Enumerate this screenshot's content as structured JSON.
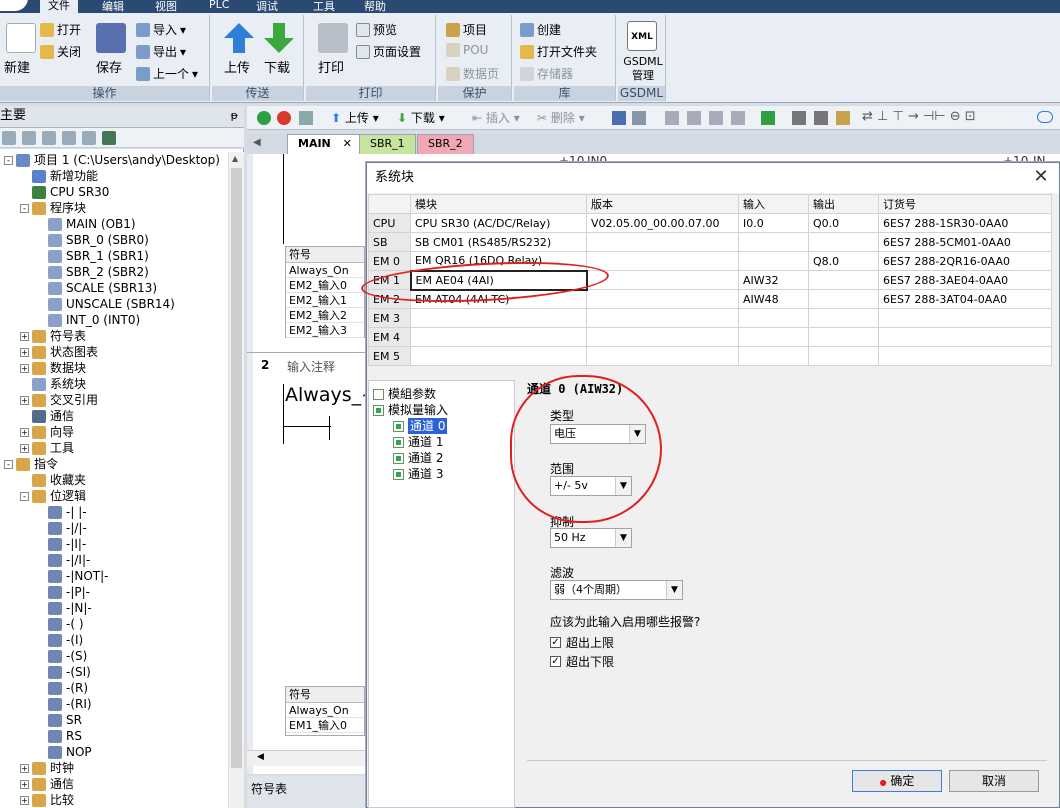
{
  "menu": {
    "items": [
      "文件",
      "编辑",
      "视图",
      "PLC",
      "调试",
      "工具",
      "帮助"
    ]
  },
  "ribbon": {
    "groups": {
      "ops": {
        "label": "操作",
        "new": "新建",
        "open": "打开",
        "close": "关闭",
        "save": "保存",
        "import": "导入",
        "export": "导出",
        "prev": "上一个"
      },
      "transfer": {
        "label": "传送",
        "upload": "上传",
        "download": "下载"
      },
      "print": {
        "label": "打印",
        "print": "打印",
        "preview": "预览",
        "pagesetup": "页面设置"
      },
      "protect": {
        "label": "保护",
        "project": "项目",
        "pou": "POU",
        "datapage": "数据页"
      },
      "lib": {
        "label": "库",
        "create": "创建",
        "openfolder": "打开文件夹",
        "memory": "存储器"
      },
      "gsdml": {
        "label": "GSDML",
        "text": "GSDML 管理",
        "icon_text": "XML"
      }
    }
  },
  "tree": {
    "header": "主要",
    "items": [
      {
        "label": "项目 1 (C:\\Users\\andy\\Desktop)",
        "icon": "project-icon",
        "color": "#6b89c4"
      },
      {
        "label": "新增功能",
        "icon": "help-icon",
        "color": "#5a7fcf"
      },
      {
        "label": "CPU SR30",
        "icon": "cpu-icon",
        "color": "#3f7f3f"
      },
      {
        "label": "程序块",
        "icon": "folder-icon",
        "color": "#d7a64a"
      },
      {
        "label": "MAIN (OB1)",
        "icon": "block-icon",
        "color": "#8aa0c6"
      },
      {
        "label": "SBR_0 (SBR0)",
        "icon": "block-icon",
        "color": "#8aa0c6"
      },
      {
        "label": "SBR_1 (SBR1)",
        "icon": "block-icon",
        "color": "#8aa0c6"
      },
      {
        "label": "SBR_2 (SBR2)",
        "icon": "block-icon",
        "color": "#8aa0c6"
      },
      {
        "label": "SCALE (SBR13)",
        "icon": "block-icon",
        "color": "#8aa0c6"
      },
      {
        "label": "UNSCALE (SBR14)",
        "icon": "block-icon",
        "color": "#8aa0c6"
      },
      {
        "label": "INT_0 (INT0)",
        "icon": "block-icon",
        "color": "#8aa0c6"
      },
      {
        "label": "符号表",
        "icon": "folder-icon",
        "color": "#d7a64a"
      },
      {
        "label": "状态图表",
        "icon": "folder-icon",
        "color": "#d7a64a"
      },
      {
        "label": "数据块",
        "icon": "folder-icon",
        "color": "#d7a64a"
      },
      {
        "label": "系统块",
        "icon": "system-block-icon",
        "color": "#8aa0c6"
      },
      {
        "label": "交叉引用",
        "icon": "folder-icon",
        "color": "#d7a64a"
      },
      {
        "label": "通信",
        "icon": "comm-icon",
        "color": "#556b8a"
      },
      {
        "label": "向导",
        "icon": "wizard-icon",
        "color": "#d7a64a"
      },
      {
        "label": "工具",
        "icon": "folder-icon",
        "color": "#d7a64a"
      },
      {
        "label": "指令",
        "icon": "folder-icon",
        "color": "#d7a64a"
      },
      {
        "label": "收藏夹",
        "icon": "favorites-icon",
        "color": "#d7a64a"
      },
      {
        "label": "位逻辑",
        "icon": "folder-icon",
        "color": "#d7a64a"
      },
      {
        "label": "-| |-",
        "icon": "contact-icon",
        "color": "#6f88b3"
      },
      {
        "label": "-|/|-",
        "icon": "contact-icon",
        "color": "#6f88b3"
      },
      {
        "label": "-|I|-",
        "icon": "contact-icon",
        "color": "#6f88b3"
      },
      {
        "label": "-|/I|-",
        "icon": "contact-icon",
        "color": "#6f88b3"
      },
      {
        "label": "-|NOT|-",
        "icon": "contact-icon",
        "color": "#6f88b3"
      },
      {
        "label": "-|P|-",
        "icon": "contact-icon",
        "color": "#6f88b3"
      },
      {
        "label": "-|N|-",
        "icon": "contact-icon",
        "color": "#6f88b3"
      },
      {
        "label": "-( )",
        "icon": "coil-icon",
        "color": "#6f88b3"
      },
      {
        "label": "-(I)",
        "icon": "coil-icon",
        "color": "#6f88b3"
      },
      {
        "label": "-(S)",
        "icon": "coil-icon",
        "color": "#6f88b3"
      },
      {
        "label": "-(SI)",
        "icon": "coil-icon",
        "color": "#6f88b3"
      },
      {
        "label": "-(R)",
        "icon": "coil-icon",
        "color": "#6f88b3"
      },
      {
        "label": "-(RI)",
        "icon": "coil-icon",
        "color": "#6f88b3"
      },
      {
        "label": "SR",
        "icon": "box-icon",
        "color": "#6f88b3"
      },
      {
        "label": "RS",
        "icon": "box-icon",
        "color": "#6f88b3"
      },
      {
        "label": "NOP",
        "icon": "box-icon",
        "color": "#6f88b3"
      },
      {
        "label": "时钟",
        "icon": "folder-icon",
        "color": "#d7a64a"
      },
      {
        "label": "通信",
        "icon": "folder-icon",
        "color": "#d7a64a"
      },
      {
        "label": "比较",
        "icon": "folder-icon",
        "color": "#d7a64a"
      }
    ]
  },
  "editor": {
    "toolbar": {
      "upload": "上传",
      "download": "下载",
      "insert": "插入",
      "delete": "删除"
    },
    "tabs": [
      "MAIN",
      "SBR_1",
      "SBR_2"
    ],
    "symbol_header": "符号",
    "symbols_top": [
      "Always_On",
      "EM2_输入0",
      "EM2_输入1",
      "EM2_输入2",
      "EM2_输入3"
    ],
    "network2_num": "2",
    "network2_comment": "输入注释",
    "always_label": "Always_~",
    "symbol_header2": "符号",
    "symbols_bottom": [
      "Always_On",
      "EM1_输入0"
    ],
    "bottom_tab": "符号表",
    "rung_top_a": "+10",
    "rung_top_b": "IN0",
    "rung_top_c": "+10",
    "rung_top_d": "IN"
  },
  "dialog": {
    "title": "系统块",
    "columns": [
      "",
      "模块",
      "版本",
      "输入",
      "输出",
      "订货号"
    ],
    "rows": [
      {
        "slot": "CPU",
        "module": "CPU SR30 (AC/DC/Relay)",
        "version": "V02.05.00_00.00.07.00",
        "input": "I0.0",
        "output": "Q0.0",
        "order": "6ES7 288-1SR30-0AA0"
      },
      {
        "slot": "SB",
        "module": "SB CM01 (RS485/RS232)",
        "version": "",
        "input": "",
        "output": "",
        "order": "6ES7 288-5CM01-0AA0"
      },
      {
        "slot": "EM 0",
        "module": "EM QR16 (16DQ Relay)",
        "version": "",
        "input": "",
        "output": "Q8.0",
        "order": "6ES7 288-2QR16-0AA0"
      },
      {
        "slot": "EM 1",
        "module": "EM AE04 (4AI)",
        "version": "",
        "input": "AIW32",
        "output": "",
        "order": "6ES7 288-3AE04-0AA0"
      },
      {
        "slot": "EM 2",
        "module": "EM AT04 (4AI TC)",
        "version": "",
        "input": "AIW48",
        "output": "",
        "order": "6ES7 288-3AT04-0AA0"
      },
      {
        "slot": "EM 3",
        "module": "",
        "version": "",
        "input": "",
        "output": "",
        "order": ""
      },
      {
        "slot": "EM 4",
        "module": "",
        "version": "",
        "input": "",
        "output": "",
        "order": ""
      },
      {
        "slot": "EM 5",
        "module": "",
        "version": "",
        "input": "",
        "output": "",
        "order": ""
      }
    ],
    "nav": {
      "module_params": "模組参数",
      "analog_input": "模拟量输入",
      "channels": [
        "通道 0",
        "通道 1",
        "通道 2",
        "通道 3"
      ]
    },
    "props": {
      "channel_title": "通道 0 (AIW32)",
      "type_label": "类型",
      "type_value": "电压",
      "range_label": "范围",
      "range_value": "+/- 5v",
      "rejection_label": "抑制",
      "rejection_value": "50 Hz",
      "filter_label": "滤波",
      "filter_value": "弱（4个周期）",
      "alarm_question": "应该为此输入启用哪些报警?",
      "alarm_upper": "超出上限",
      "alarm_lower": "超出下限",
      "alarm_upper_checked": true,
      "alarm_lower_checked": true
    },
    "ok": "确定",
    "cancel": "取消"
  },
  "colors": {
    "accent": "#2b62d6",
    "annotation": "#e02020",
    "menubar": "#2b4a73"
  }
}
